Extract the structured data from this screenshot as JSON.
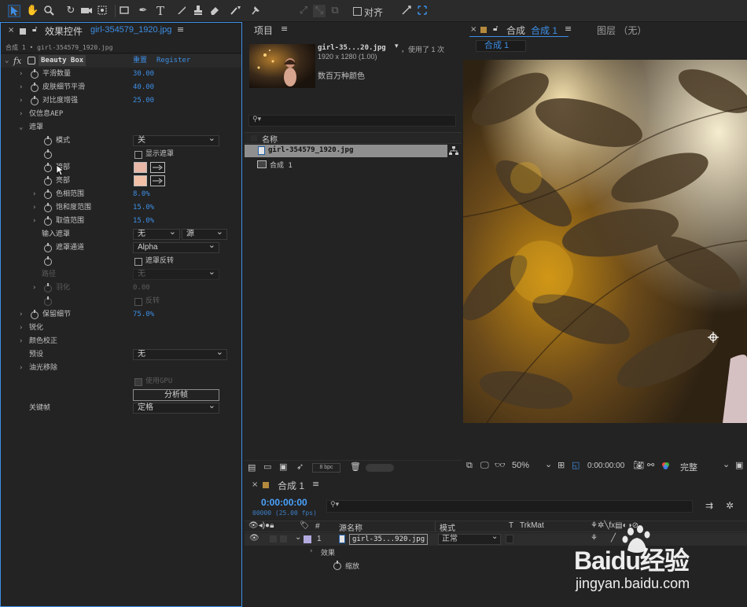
{
  "toolbar": {
    "align_label": "对齐"
  },
  "effects_panel": {
    "tab_title": "效果控件",
    "tab_file": "girl-354579_1920.jpg",
    "subtitle": "合成 1 • girl-354579_1920.jpg",
    "fx_label": "fx",
    "effect_name": "Beauty Box",
    "reset": "重置",
    "register": "Register",
    "props": [
      {
        "label": "平滑数量",
        "value": "30.00"
      },
      {
        "label": "皮肤细节平滑",
        "value": "40.00"
      },
      {
        "label": "对比度增强",
        "value": "25.00"
      }
    ],
    "only_aep": "仅信息AEP",
    "mask": "遮罩",
    "mode_label": "模式",
    "mode_value": "关",
    "show_mask": "显示遮罩",
    "dark_label": "暗部",
    "light_label": "亮部",
    "hue_range": {
      "label": "色相范围",
      "value": "8.0%"
    },
    "sat_range": {
      "label": "饱和度范围",
      "value": "15.0%"
    },
    "val_range": {
      "label": "取值范围",
      "value": "15.0%"
    },
    "input_mask": "输入遮罩",
    "input_mask_value": "无",
    "input_mask_source": "源",
    "mask_channel": "遮罩通道",
    "mask_channel_value": "Alpha",
    "mask_invert": "遮罩反转",
    "path_label": "路径",
    "path_value": "无",
    "feather_label": "羽化",
    "feather_value": "0.00",
    "invert_label": "反转",
    "keep_detail": {
      "label": "保留细节",
      "value": "75.0%"
    },
    "sharpen": "锐化",
    "color_correct": "颜色校正",
    "preset_label": "预设",
    "preset_value": "无",
    "shine_remove": "油光移除",
    "use_gpu": "使用GPU",
    "analyze_btn": "分析帧",
    "keyframe_label": "关键帧",
    "keyframe_value": "定格"
  },
  "colors": {
    "swatch_dark": "#e8b7a8",
    "swatch_light": "#f2c0a6",
    "accent_blue": "#3d8fe6",
    "timecode": "#4aa3ff"
  },
  "project_panel": {
    "title": "项目",
    "file_name": "girl-35...20.jpg",
    "usage": "，使用了 1 次",
    "dimensions": "1920 x 1280 (1.00)",
    "colors": "数百万种颜色",
    "col_name": "名称",
    "items": [
      {
        "name": "girl-354579_1920.jpg"
      },
      {
        "name": "合成 1"
      }
    ],
    "bpc": "8 bpc"
  },
  "comp_panel": {
    "tab_label": "合成",
    "tab_name": "合成 1",
    "layer_tab": "图层 （无）",
    "sub_tab": "合成 1",
    "zoom": "50%",
    "timecode": "0:00:00:00",
    "quality": "完整"
  },
  "timeline": {
    "tab": "合成 1",
    "timecode": "0:00:00:00",
    "fps": "00000 (25.00 fps)",
    "col_num": "#",
    "col_source": "源名称",
    "col_mode": "模式",
    "col_t": "T",
    "col_trkmat": "TrkMat",
    "layer_num": "1",
    "layer_name": "girl-35...920.jpg",
    "layer_mode": "正常",
    "effects_label": "效果",
    "scale_label": "缩放"
  },
  "watermark": {
    "text": "Baidu经验",
    "url": "jingyan.baidu.com"
  }
}
